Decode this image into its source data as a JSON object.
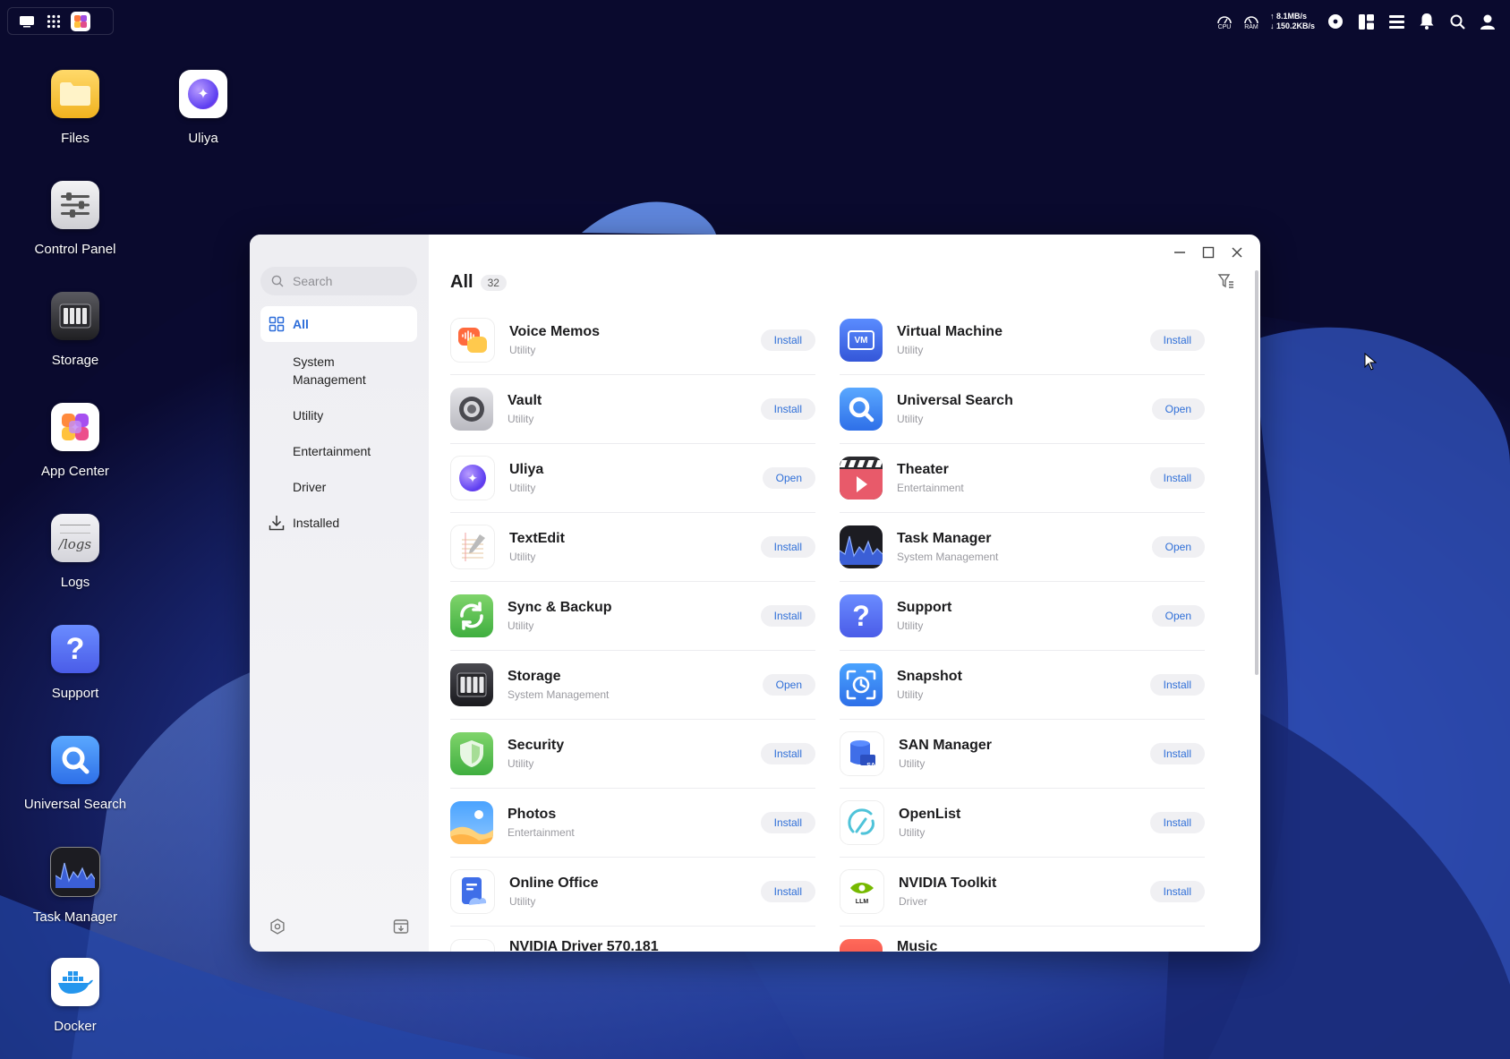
{
  "desktop": {
    "icons": [
      {
        "label": "Files",
        "icon": "folder-icon"
      },
      {
        "label": "Uliya",
        "icon": "uliya-icon"
      },
      {
        "label": "Control Panel",
        "icon": "sliders-icon"
      },
      {
        "label": "Storage",
        "icon": "storage-icon"
      },
      {
        "label": "App Center",
        "icon": "app-center-icon"
      },
      {
        "label": "Logs",
        "icon": "logs-icon",
        "text": "/logs"
      },
      {
        "label": "Support",
        "icon": "question-icon",
        "text": "?"
      },
      {
        "label": "Universal Search",
        "icon": "search-icon"
      },
      {
        "label": "Task Manager",
        "icon": "chart-icon"
      },
      {
        "label": "Docker",
        "icon": "docker-icon"
      }
    ]
  },
  "topbar": {
    "cpu_label": "CPU",
    "ram_label": "RAM",
    "net_up": "↑ 8.1MB/s",
    "net_down": "↓ 150.2KB/s"
  },
  "appcenter": {
    "search_placeholder": "Search",
    "nav": [
      {
        "label": "All",
        "active": true,
        "icon": "grid-icon"
      },
      {
        "label": "System Management"
      },
      {
        "label": "Utility"
      },
      {
        "label": "Entertainment"
      },
      {
        "label": "Driver"
      },
      {
        "label": "Installed",
        "icon": "download-icon"
      }
    ],
    "title": "All",
    "count": "32",
    "apps_left": [
      {
        "name": "Voice Memos",
        "category": "Utility",
        "action": "Install"
      },
      {
        "name": "Vault",
        "category": "Utility",
        "action": "Install"
      },
      {
        "name": "Uliya",
        "category": "Utility",
        "action": "Open"
      },
      {
        "name": "TextEdit",
        "category": "Utility",
        "action": "Install"
      },
      {
        "name": "Sync & Backup",
        "category": "Utility",
        "action": "Install"
      },
      {
        "name": "Storage",
        "category": "System Management",
        "action": "Open"
      },
      {
        "name": "Security",
        "category": "Utility",
        "action": "Install"
      },
      {
        "name": "Photos",
        "category": "Entertainment",
        "action": "Install"
      },
      {
        "name": "Online Office",
        "category": "Utility",
        "action": "Install"
      },
      {
        "name": "NVIDIA Driver 570.181",
        "category": "",
        "action": ""
      }
    ],
    "apps_right": [
      {
        "name": "Virtual Machine",
        "category": "Utility",
        "action": "Install",
        "icon_text": "VM"
      },
      {
        "name": "Universal Search",
        "category": "Utility",
        "action": "Open"
      },
      {
        "name": "Theater",
        "category": "Entertainment",
        "action": "Install"
      },
      {
        "name": "Task Manager",
        "category": "System Management",
        "action": "Open"
      },
      {
        "name": "Support",
        "category": "Utility",
        "action": "Open",
        "icon_text": "?"
      },
      {
        "name": "Snapshot",
        "category": "Utility",
        "action": "Install"
      },
      {
        "name": "SAN Manager",
        "category": "Utility",
        "action": "Install",
        "icon_text": "SAN"
      },
      {
        "name": "OpenList",
        "category": "Utility",
        "action": "Install"
      },
      {
        "name": "NVIDIA Toolkit",
        "category": "Driver",
        "action": "Install",
        "icon_text": "LLM"
      },
      {
        "name": "Music",
        "category": "",
        "action": ""
      }
    ]
  }
}
